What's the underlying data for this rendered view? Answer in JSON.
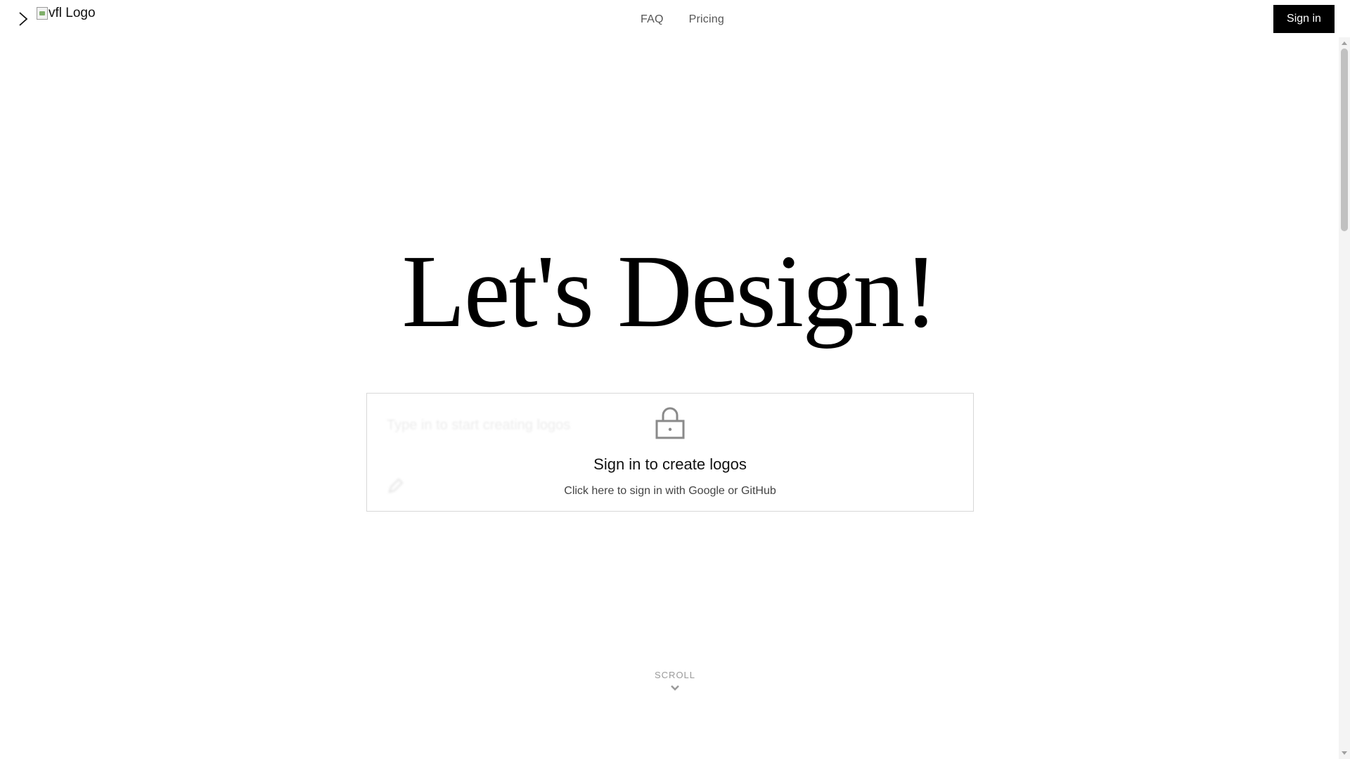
{
  "header": {
    "logo_alt": "vfl Logo",
    "nav": [
      {
        "label": "FAQ"
      },
      {
        "label": "Pricing"
      }
    ],
    "signin_label": "Sign in"
  },
  "hero": {
    "title": "Let's Design!"
  },
  "prompt_card": {
    "ghost_placeholder": "Type in to start creating logos",
    "title": "Sign in to create logos",
    "subtitle": "Click here to sign in with Google or GitHub"
  },
  "scroll_hint": {
    "label": "SCROLL"
  },
  "icons": {
    "sidebar_toggle": "chevron-right-icon",
    "lock": "lock-icon",
    "scroll": "chevron-down-icon"
  },
  "colors": {
    "signin_bg": "#000000",
    "signin_text": "#ffffff",
    "nav_text": "#555555",
    "card_border": "#d8d8d8"
  }
}
